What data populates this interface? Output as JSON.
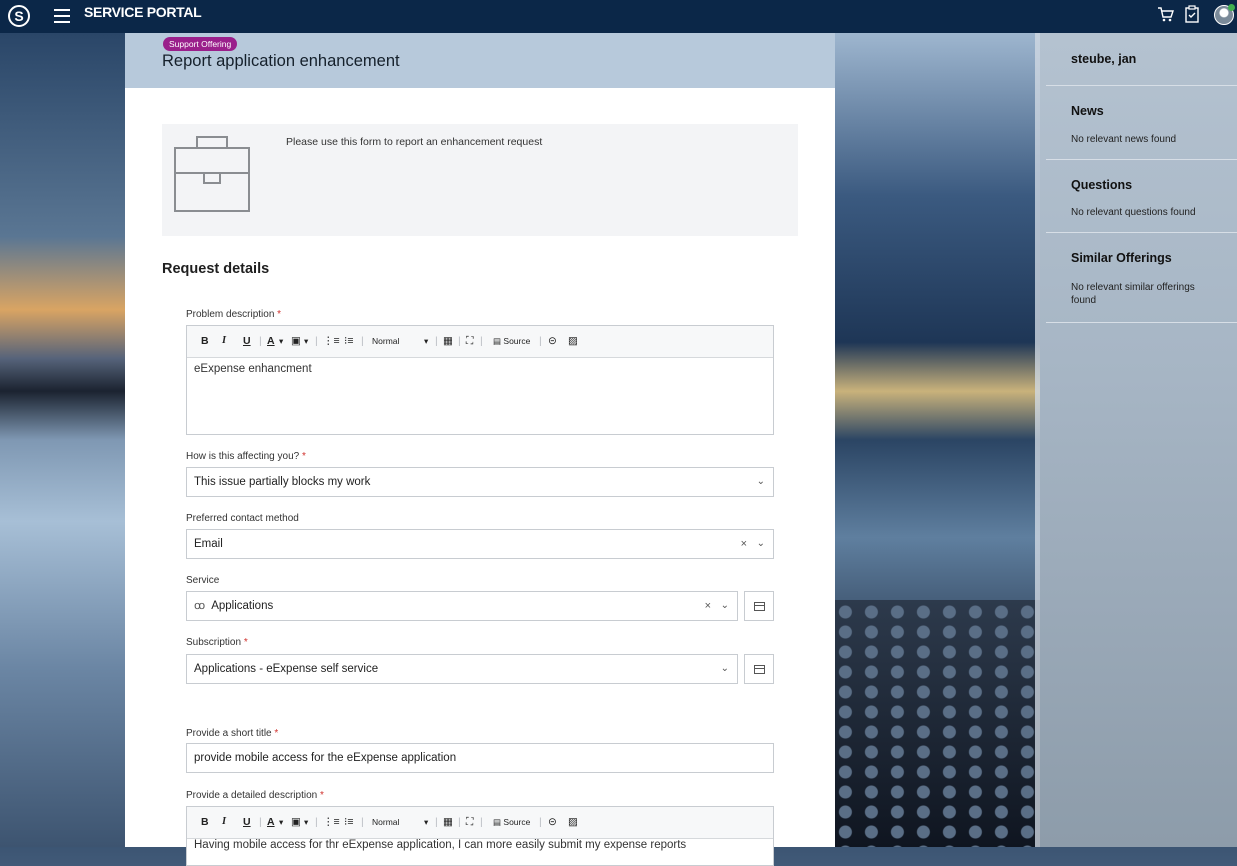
{
  "topbar": {
    "brand": "SERVICE PORTAL",
    "icons": [
      "logo-icon",
      "menu-icon",
      "cart-icon",
      "clipboard-icon",
      "avatar"
    ]
  },
  "header": {
    "badge": "Support Offering",
    "title": "Report application enhancement"
  },
  "intro": {
    "icon": "briefcase-icon",
    "text": "Please use this form to report an enhancement request"
  },
  "section": {
    "title": "Request details"
  },
  "editor_toolbar": {
    "buttons": [
      "B",
      "I",
      "U",
      "A",
      "▾",
      "▾",
      "Normal",
      "▾",
      "Source"
    ],
    "format": "Normal",
    "source": "Source"
  },
  "form": {
    "problem_description": {
      "label": "Problem description",
      "required": "*",
      "value": "eExpense enhancment"
    },
    "affecting": {
      "label": "How is this affecting you?",
      "required": "*",
      "value": "This issue partially blocks my work"
    },
    "contact": {
      "label": "Preferred contact method",
      "value": "Email"
    },
    "service": {
      "label": "Service",
      "value": "Applications"
    },
    "subscription": {
      "label": "Subscription",
      "required": "*",
      "value": "Applications - eExpense self service"
    },
    "short_title": {
      "label": "Provide a short title",
      "required": "*",
      "value": "provide mobile access for the eExpense application"
    },
    "detailed_description": {
      "label": "Provide a detailed description",
      "required": "*",
      "value": "Having mobile access for thr eExpense application, I can more easily submit my expense reports"
    }
  },
  "right_panel": {
    "user": "steube, jan",
    "news": {
      "title": "News",
      "text": "No relevant news found"
    },
    "questions": {
      "title": "Questions",
      "text": "No relevant questions found"
    },
    "similar": {
      "title": "Similar Offerings",
      "text": "No relevant similar offerings found"
    }
  }
}
